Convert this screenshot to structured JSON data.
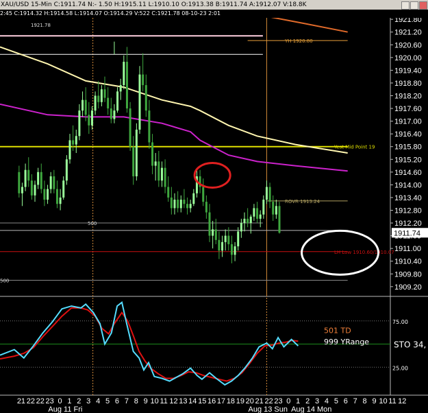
{
  "window": {
    "title": "XAU/USD 15-Min C:1911.74 N:- 1.50 H:1915.11 L:1910.10 O:1913.38 B:1911.74 A:1912.07 V:18.8K",
    "info_line": "2:45 C:1914.32 H:1914.58 L:1914.07 O:1914.29 V:522 C:1921.78 08-10-23 2:01"
  },
  "chart_data": {
    "type": "line",
    "symbol": "XAU/USD",
    "interval": "15-Min",
    "ylim": [
      1909.0,
      1922.0
    ],
    "y_ticks": [
      "1921.80",
      "1921.20",
      "1920.60",
      "1920.00",
      "1919.40",
      "1918.80",
      "1918.20",
      "1917.60",
      "1917.00",
      "1916.40",
      "1915.80",
      "1915.20",
      "1914.60",
      "1914.00",
      "1913.40",
      "1912.80",
      "1912.20",
      "1911.60",
      "1911.00",
      "1910.40",
      "1909.80",
      "1909.20"
    ],
    "last_price": "1911.74",
    "x_hours": [
      "21",
      "22",
      "22",
      "23",
      "0",
      "1",
      "2",
      "3",
      "4",
      "5",
      "6",
      "7",
      "8",
      "9",
      "10",
      "11",
      "12",
      "13",
      "14",
      "15",
      "16",
      "17",
      "18",
      "19",
      "20",
      "21",
      "22",
      "23",
      "0",
      "1",
      "2",
      "3",
      "4",
      "5",
      "6",
      "7",
      "8",
      "9",
      "10",
      "11",
      "12"
    ],
    "date_labels": [
      "Aug 11 Fri",
      "Aug 13 Sun",
      "Aug 14 Mon"
    ],
    "session_break_hours": [
      6.75,
      25
    ],
    "bars": [
      [
        1914.6,
        1914.9,
        1913.4,
        1913.6
      ],
      [
        1913.6,
        1914.1,
        1913.0,
        1913.9
      ],
      [
        1913.9,
        1915.0,
        1913.7,
        1914.7
      ],
      [
        1914.7,
        1915.3,
        1913.9,
        1914.2
      ],
      [
        1914.2,
        1914.5,
        1913.3,
        1913.5
      ],
      [
        1913.5,
        1914.2,
        1913.2,
        1914.0
      ],
      [
        1914.0,
        1914.8,
        1913.8,
        1914.6
      ],
      [
        1914.6,
        1915.0,
        1913.6,
        1913.8
      ],
      [
        1913.8,
        1914.2,
        1913.0,
        1913.3
      ],
      [
        1913.3,
        1914.0,
        1913.1,
        1913.8
      ],
      [
        1913.8,
        1914.6,
        1913.6,
        1914.4
      ],
      [
        1914.4,
        1914.7,
        1913.6,
        1913.8
      ],
      [
        1913.8,
        1914.2,
        1912.9,
        1913.1
      ],
      [
        1913.1,
        1913.8,
        1912.8,
        1913.4
      ],
      [
        1913.4,
        1914.4,
        1913.3,
        1914.2
      ],
      [
        1914.2,
        1915.4,
        1914.0,
        1915.2
      ],
      [
        1915.2,
        1916.4,
        1915.0,
        1916.1
      ],
      [
        1916.1,
        1916.8,
        1915.6,
        1915.9
      ],
      [
        1915.9,
        1916.6,
        1915.5,
        1916.3
      ],
      [
        1916.3,
        1917.8,
        1916.1,
        1917.5
      ],
      [
        1917.5,
        1918.4,
        1917.2,
        1918.0
      ],
      [
        1918.0,
        1918.6,
        1917.0,
        1917.3
      ],
      [
        1917.3,
        1917.9,
        1916.4,
        1916.8
      ],
      [
        1916.8,
        1917.7,
        1916.6,
        1917.5
      ],
      [
        1917.5,
        1918.4,
        1917.3,
        1918.2
      ],
      [
        1918.2,
        1918.9,
        1917.6,
        1917.9
      ],
      [
        1917.9,
        1918.7,
        1917.7,
        1918.5
      ],
      [
        1918.5,
        1919.1,
        1917.9,
        1918.1
      ],
      [
        1918.1,
        1918.6,
        1917.3,
        1917.6
      ],
      [
        1917.6,
        1918.1,
        1916.9,
        1917.1
      ],
      [
        1917.1,
        1917.8,
        1916.9,
        1917.5
      ],
      [
        1917.5,
        1918.6,
        1917.4,
        1918.4
      ],
      [
        1918.4,
        1919.0,
        1918.0,
        1918.7
      ],
      [
        1918.7,
        1920.1,
        1918.5,
        1919.8
      ],
      [
        1919.8,
        1920.5,
        1917.4,
        1917.6
      ],
      [
        1917.6,
        1917.9,
        1915.6,
        1915.8
      ],
      [
        1915.8,
        1916.3,
        1914.0,
        1914.4
      ],
      [
        1914.4,
        1916.9,
        1914.2,
        1916.6
      ],
      [
        1916.6,
        1919.6,
        1916.4,
        1919.2
      ],
      [
        1919.2,
        1920.2,
        1918.4,
        1918.7
      ],
      [
        1918.7,
        1919.2,
        1917.2,
        1917.5
      ],
      [
        1917.5,
        1918.0,
        1915.7,
        1916.0
      ],
      [
        1916.0,
        1916.4,
        1914.5,
        1914.9
      ],
      [
        1914.9,
        1915.5,
        1914.2,
        1915.1
      ],
      [
        1915.1,
        1915.6,
        1913.9,
        1914.2
      ],
      [
        1914.2,
        1915.1,
        1913.9,
        1914.8
      ],
      [
        1914.8,
        1915.2,
        1913.6,
        1913.9
      ],
      [
        1913.9,
        1914.4,
        1913.2,
        1913.4
      ],
      [
        1913.4,
        1913.9,
        1912.6,
        1912.9
      ],
      [
        1912.9,
        1913.6,
        1912.6,
        1913.3
      ],
      [
        1913.3,
        1913.7,
        1912.7,
        1912.9
      ],
      [
        1912.9,
        1913.5,
        1912.7,
        1913.3
      ],
      [
        1913.3,
        1913.8,
        1912.9,
        1913.1
      ],
      [
        1913.1,
        1913.4,
        1912.6,
        1912.9
      ],
      [
        1912.9,
        1913.3,
        1912.7,
        1913.1
      ],
      [
        1913.1,
        1913.8,
        1913.0,
        1913.6
      ],
      [
        1913.6,
        1914.7,
        1913.4,
        1914.4
      ],
      [
        1914.4,
        1914.7,
        1913.6,
        1913.9
      ],
      [
        1913.9,
        1914.3,
        1913.0,
        1913.2
      ],
      [
        1913.2,
        1913.5,
        1912.4,
        1912.7
      ],
      [
        1912.7,
        1913.1,
        1911.3,
        1911.6
      ],
      [
        1911.6,
        1912.3,
        1911.0,
        1911.9
      ],
      [
        1911.9,
        1912.4,
        1911.2,
        1911.4
      ],
      [
        1911.4,
        1911.8,
        1910.5,
        1910.9
      ],
      [
        1910.9,
        1911.6,
        1910.6,
        1911.3
      ],
      [
        1911.3,
        1911.9,
        1910.9,
        1911.6
      ],
      [
        1911.6,
        1912.0,
        1910.9,
        1911.2
      ],
      [
        1911.2,
        1911.6,
        1910.3,
        1910.7
      ],
      [
        1910.7,
        1911.3,
        1910.4,
        1911.1
      ],
      [
        1911.1,
        1912.0,
        1910.9,
        1911.8
      ],
      [
        1911.8,
        1912.4,
        1911.5,
        1912.2
      ],
      [
        1912.2,
        1912.7,
        1911.8,
        1912.4
      ],
      [
        1912.4,
        1912.9,
        1912.0,
        1912.2
      ],
      [
        1912.2,
        1912.6,
        1911.7,
        1912.5
      ],
      [
        1912.5,
        1913.1,
        1912.3,
        1912.9
      ],
      [
        1912.9,
        1913.2,
        1912.2,
        1912.4
      ],
      [
        1912.4,
        1912.8,
        1912.0,
        1912.6
      ],
      [
        1912.6,
        1913.5,
        1912.4,
        1913.3
      ],
      [
        1913.3,
        1914.2,
        1913.1,
        1913.9
      ],
      [
        1913.9,
        1914.1,
        1912.9,
        1913.2
      ],
      [
        1913.2,
        1913.5,
        1912.3,
        1912.6
      ],
      [
        1912.6,
        1913.3,
        1912.4,
        1913.0
      ],
      [
        1913.0,
        1913.2,
        1911.7,
        1911.74
      ]
    ],
    "ma_yellow": [
      [
        -3,
        1920.5
      ],
      [
        2,
        1919.7
      ],
      [
        6,
        1918.9
      ],
      [
        10,
        1918.6
      ],
      [
        14,
        1918.0
      ],
      [
        17,
        1917.7
      ],
      [
        18,
        1917.5
      ],
      [
        21,
        1916.8
      ],
      [
        24,
        1916.3
      ],
      [
        28,
        1915.9
      ],
      [
        33.5,
        1915.5
      ]
    ],
    "ma_magenta": [
      [
        -3,
        1917.8
      ],
      [
        2,
        1917.3
      ],
      [
        6,
        1917.2
      ],
      [
        10,
        1917.2
      ],
      [
        14,
        1916.9
      ],
      [
        17,
        1916.5
      ],
      [
        18,
        1916.1
      ],
      [
        21,
        1915.4
      ],
      [
        24,
        1915.1
      ],
      [
        28,
        1914.9
      ],
      [
        33.5,
        1914.65
      ]
    ],
    "ma_orange": [
      [
        25.5,
        1921.9
      ],
      [
        29,
        1921.6
      ],
      [
        33.5,
        1921.2
      ]
    ],
    "levels": [
      {
        "label": "YH 1920.80",
        "price": 1920.8,
        "color": "#e8a13a",
        "from": 23,
        "to": 33.5,
        "label_pos": "right"
      },
      {
        "label": "Yest Mid Point 19",
        "price": 1915.8,
        "color": "#e0e000",
        "from": -3,
        "to": 33.5,
        "label_pos": "far-right"
      },
      {
        "label": "ROVR 1913.24",
        "price": 1913.24,
        "color": "#b0a060",
        "from": 25,
        "to": 33.5,
        "label_pos": "right"
      },
      {
        "label": "LH Low 1910.60/1910.07",
        "price": 1910.85,
        "color": "#cc1111",
        "from": -3,
        "to": 33.5,
        "label_pos": "far-right"
      }
    ],
    "annotations": [
      {
        "label": "1921.78",
        "price": 1921.55
      },
      {
        "label": "500",
        "price": 1912.2
      },
      {
        "label": "500",
        "price": 1909.5
      }
    ],
    "oscillator": {
      "labels": [
        "501 TD",
        "999 YRange",
        "STO 34,"
      ],
      "y_ticks": [
        "75.00",
        "25.00"
      ],
      "ylim": [
        0,
        100
      ],
      "k": [
        [
          -3,
          38
        ],
        [
          -1.5,
          44
        ],
        [
          -0.5,
          35
        ],
        [
          0.5,
          48
        ],
        [
          1.5,
          62
        ],
        [
          2.5,
          74
        ],
        [
          3.5,
          88
        ],
        [
          4.5,
          91
        ],
        [
          5.5,
          89
        ],
        [
          6,
          93
        ],
        [
          6.8,
          84
        ],
        [
          7.5,
          72
        ],
        [
          8,
          50
        ],
        [
          8.7,
          62
        ],
        [
          9.3,
          91
        ],
        [
          9.8,
          95
        ],
        [
          10.3,
          72
        ],
        [
          11,
          42
        ],
        [
          11.6,
          35
        ],
        [
          12.1,
          22
        ],
        [
          12.6,
          30
        ],
        [
          13.2,
          15
        ],
        [
          14,
          13
        ],
        [
          14.8,
          10
        ],
        [
          15.5,
          14
        ],
        [
          16.2,
          18
        ],
        [
          17,
          24
        ],
        [
          17.7,
          16
        ],
        [
          18.2,
          12
        ],
        [
          19,
          19
        ],
        [
          19.7,
          13
        ],
        [
          20.6,
          6
        ],
        [
          21.3,
          10
        ],
        [
          22,
          16
        ],
        [
          22.7,
          24
        ],
        [
          23.5,
          35
        ],
        [
          24.2,
          47
        ],
        [
          25,
          51
        ],
        [
          25.6,
          45
        ],
        [
          26.2,
          57
        ],
        [
          26.8,
          47
        ],
        [
          27.6,
          55
        ],
        [
          28.3,
          48
        ]
      ],
      "d": [
        [
          -3,
          34
        ],
        [
          -1.5,
          37
        ],
        [
          -0.5,
          40
        ],
        [
          0.5,
          46
        ],
        [
          1.5,
          58
        ],
        [
          2.5,
          69
        ],
        [
          3.5,
          80
        ],
        [
          4.5,
          89
        ],
        [
          5.5,
          89
        ],
        [
          6.2,
          87
        ],
        [
          7,
          80
        ],
        [
          7.7,
          67
        ],
        [
          8.4,
          61
        ],
        [
          9,
          72
        ],
        [
          9.8,
          84
        ],
        [
          10.4,
          75
        ],
        [
          11,
          59
        ],
        [
          11.6,
          42
        ],
        [
          12.2,
          32
        ],
        [
          12.8,
          24
        ],
        [
          13.6,
          18
        ],
        [
          14.4,
          13
        ],
        [
          15.2,
          13
        ],
        [
          16,
          16
        ],
        [
          16.8,
          20
        ],
        [
          17.6,
          19
        ],
        [
          18.4,
          16
        ],
        [
          19.2,
          14
        ],
        [
          20,
          12
        ],
        [
          20.8,
          10
        ],
        [
          21.6,
          13
        ],
        [
          22.4,
          19
        ],
        [
          23.2,
          29
        ],
        [
          24,
          40
        ],
        [
          24.8,
          48
        ],
        [
          25.6,
          49
        ],
        [
          26.3,
          51
        ],
        [
          27,
          52
        ],
        [
          27.7,
          54
        ],
        [
          28.3,
          53
        ]
      ]
    },
    "colors": {
      "up": "#9aff9a",
      "down": "#3fa83f",
      "ma_yellow": "#fff6b0",
      "ma_magenta": "#cc22cc",
      "ma_orange": "#e06a2a",
      "stoch_k": "#55ddff",
      "stoch_d": "#dd1111",
      "grid": "#3a3a3a",
      "session": "#d28a3a"
    },
    "markings": {
      "red_ellipse_center": {
        "hour": 19.3,
        "price": 1914.45
      },
      "white_ellipse_center": {
        "hour": 32.7,
        "price": 1910.8
      }
    }
  }
}
